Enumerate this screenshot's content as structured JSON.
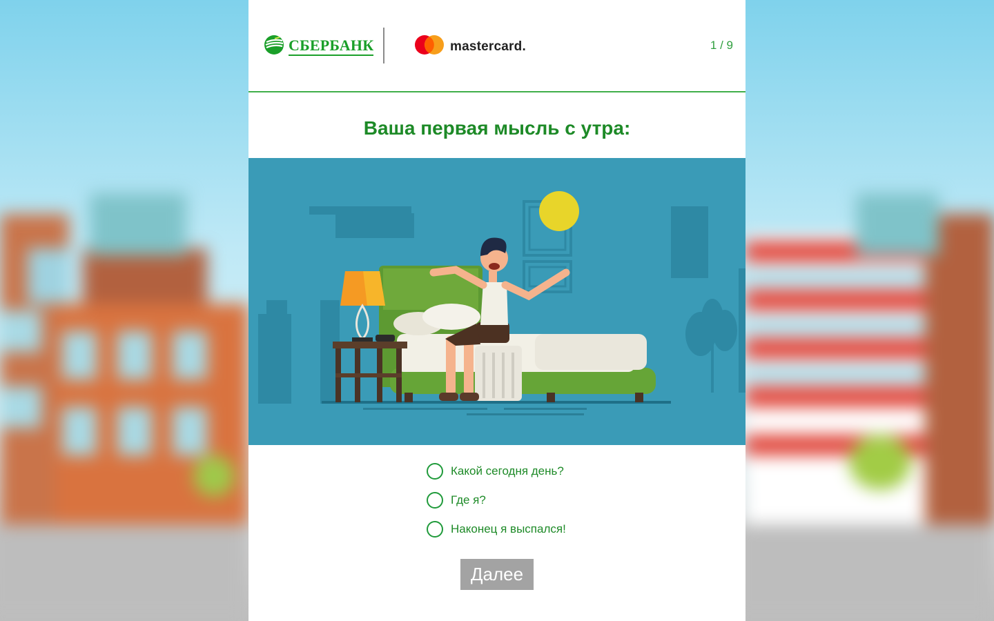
{
  "header": {
    "bank_name": "СБЕРБАНК",
    "partner_name": "mastercard",
    "partner_trademark": ".",
    "progress": "1 / 9"
  },
  "quiz": {
    "question": "Ваша первая мысль с утра:",
    "options": [
      {
        "label": "Какой сегодня день?"
      },
      {
        "label": "Где я?"
      },
      {
        "label": "Наконец я выспался!"
      }
    ],
    "next_label": "Далее"
  },
  "icons": {
    "bank_logo": "sberbank-logo-icon",
    "partner_logo": "mastercard-logo-icon",
    "illustration": "man-waking-up-in-bed-illustration"
  },
  "colors": {
    "brand_green": "#1d8a27",
    "divider_green": "#3fae49",
    "illustration_bg": "#3a9bb7",
    "button_disabled": "#a3a3a3",
    "mc_red": "#eb001b",
    "mc_orange": "#f79e1b"
  }
}
